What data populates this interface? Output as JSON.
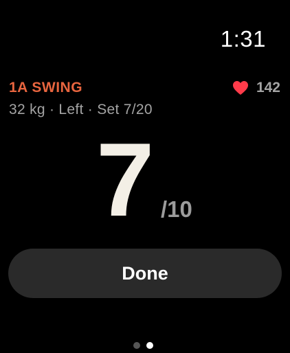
{
  "status": {
    "time": "1:31"
  },
  "exercise": {
    "name": "1A SWING",
    "details": "32 kg · Left · Set 7/20"
  },
  "heart_rate": {
    "icon": "heart-icon",
    "value": "142",
    "color": "#ff3b4a"
  },
  "reps": {
    "current": "7",
    "total": "/10"
  },
  "actions": {
    "done_label": "Done"
  },
  "pager": {
    "pages": 2,
    "active_index": 1
  },
  "colors": {
    "accent": "#e8653f",
    "background": "#000000"
  }
}
